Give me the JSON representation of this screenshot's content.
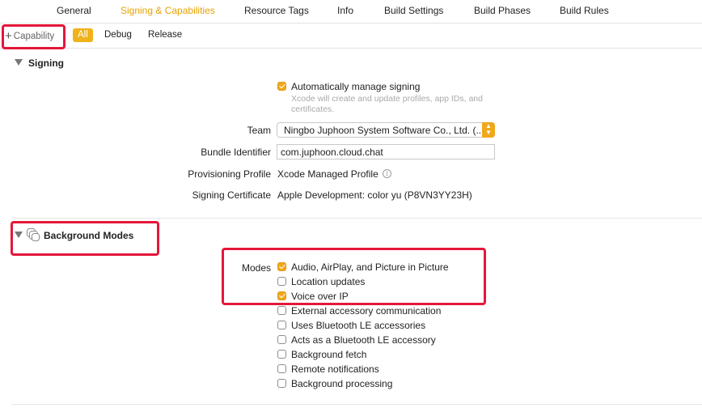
{
  "tabs": [
    {
      "label": "General",
      "active": false
    },
    {
      "label": "Signing & Capabilities",
      "active": true
    },
    {
      "label": "Resource Tags",
      "active": false
    },
    {
      "label": "Info",
      "active": false
    },
    {
      "label": "Build Settings",
      "active": false
    },
    {
      "label": "Build Phases",
      "active": false
    },
    {
      "label": "Build Rules",
      "active": false
    }
  ],
  "toolbar": {
    "capability_label": "Capability",
    "filters": [
      "All",
      "Debug",
      "Release"
    ],
    "active_filter": "All"
  },
  "signing": {
    "header": "Signing",
    "auto_manage_label": "Automatically manage signing",
    "auto_manage_checked": true,
    "auto_manage_subtext_1": "Xcode will create and update profiles, app IDs, and",
    "auto_manage_subtext_2": "certificates.",
    "team_label": "Team",
    "team_value": "Ningbo Juphoon System Software Co., Ltd. (...",
    "bundle_label": "Bundle Identifier",
    "bundle_value": "com.juphoon.cloud.chat",
    "profile_label": "Provisioning Profile",
    "profile_value": "Xcode Managed Profile",
    "certificate_label": "Signing Certificate",
    "certificate_value": "Apple Development: color yu (P8VN3YY23H)"
  },
  "background_modes": {
    "header": "Background Modes",
    "modes_label": "Modes",
    "modes": [
      {
        "label": "Audio, AirPlay, and Picture in Picture",
        "checked": true
      },
      {
        "label": "Location updates",
        "checked": false
      },
      {
        "label": "Voice over IP",
        "checked": true
      },
      {
        "label": "External accessory communication",
        "checked": false
      },
      {
        "label": "Uses Bluetooth LE accessories",
        "checked": false
      },
      {
        "label": "Acts as a Bluetooth LE accessory",
        "checked": false
      },
      {
        "label": "Background fetch",
        "checked": false
      },
      {
        "label": "Remote notifications",
        "checked": false
      },
      {
        "label": "Background processing",
        "checked": false
      }
    ]
  },
  "colors": {
    "accent": "#f0a81b",
    "active_tab": "#e8a200",
    "highlight": "#e5173a"
  },
  "icons": {
    "add": "plus-icon",
    "disclosure": "disclosure-triangle-icon",
    "background_modes": "background-modes-icon",
    "info": "info-icon",
    "popup": "popup-stepper-icon"
  }
}
